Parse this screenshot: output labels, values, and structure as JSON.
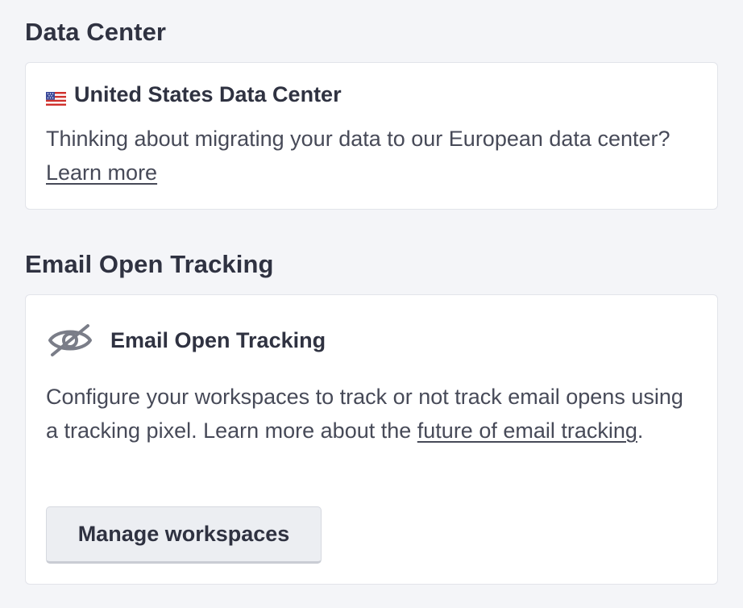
{
  "data_center": {
    "section_title": "Data Center",
    "card_title": "United States Data Center",
    "flag_icon": "us-flag-icon",
    "description_prefix": "Thinking about migrating your data to our European data center? ",
    "learn_more_link": "Learn more"
  },
  "email_open_tracking": {
    "section_title": "Email Open Tracking",
    "card_title": "Email Open Tracking",
    "icon": "eye-slash-icon",
    "description_prefix": "Configure your workspaces to track or not track email opens using a tracking pixel. Learn more about the ",
    "link_text": "future of email tracking",
    "description_suffix": ".",
    "button_label": "Manage workspaces"
  },
  "colors": {
    "background": "#f4f5f8",
    "card": "#ffffff",
    "text": "#2f3241",
    "button_bg": "#eceef2"
  }
}
